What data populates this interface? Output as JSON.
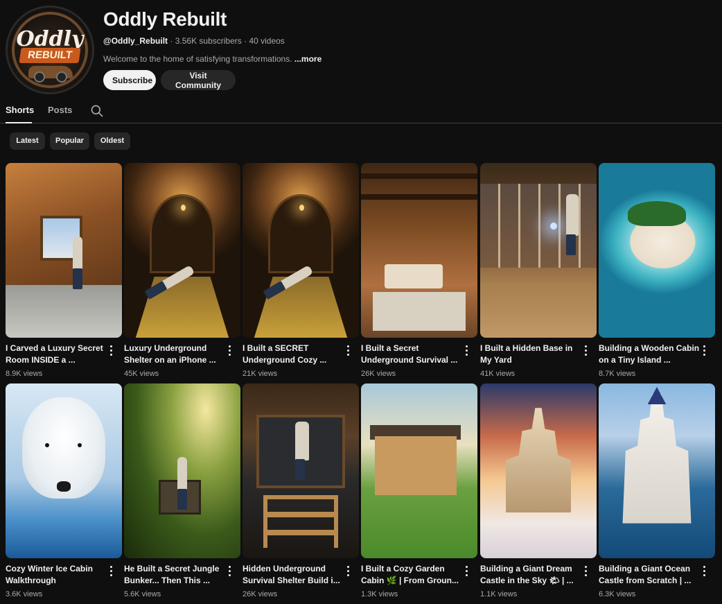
{
  "channel": {
    "name": "Oddly Rebuilt",
    "handle": "@Oddly_Rebuilt",
    "subscribers": "3.56K subscribers",
    "videos": "40 videos",
    "separator": " · ",
    "description": "Welcome to the home of satisfying transformations. ",
    "more_label": "...more",
    "logo_line1": "Oddly",
    "logo_line2": "REBUILT",
    "subscribe_label": "Subscribe",
    "community_label": "Visit Community"
  },
  "tabs": [
    {
      "label": "Shorts",
      "active": true
    },
    {
      "label": "Posts",
      "active": false
    }
  ],
  "filters": [
    "Latest",
    "Popular",
    "Oldest"
  ],
  "shorts": [
    {
      "title": "I Carved a Luxury Secret Room INSIDE a ...",
      "views": "8.9K views",
      "art": "th-room"
    },
    {
      "title": "Luxury Underground Shelter on an iPhone ...",
      "views": "45K views",
      "art": "th-tunnel"
    },
    {
      "title": "I Built a SECRET Underground Cozy ...",
      "views": "21K views",
      "art": "th-tunnel"
    },
    {
      "title": "I Built a Secret Underground Survival ...",
      "views": "26K views",
      "art": "th-bedroom"
    },
    {
      "title": "I Built a Hidden Base in My Yard",
      "views": "41K views",
      "art": "th-base"
    },
    {
      "title": "Building a Wooden Cabin on a Tiny Island ...",
      "views": "8.7K views",
      "art": "th-island"
    },
    {
      "title": "Cozy Winter Ice Cabin Walkthrough",
      "views": "3.6K views",
      "art": "th-bear"
    },
    {
      "title": "He Built a Secret Jungle Bunker... Then This ...",
      "views": "5.6K views",
      "art": "th-jungle"
    },
    {
      "title": "Hidden Underground Survival Shelter Build i...",
      "views": "26K views",
      "art": "th-shelter"
    },
    {
      "title": "I Built  a Cozy Garden Cabin 🌿 | From Groun...",
      "views": "1.3K views",
      "art": "th-garden"
    },
    {
      "title": "Building a Giant Dream Castle in the Sky 🌤 | ...",
      "views": "1.1K views",
      "art": "th-sky"
    },
    {
      "title": "Building a Giant Ocean Castle from Scratch | ...",
      "views": "6.3K views",
      "art": "th-ocean"
    }
  ]
}
